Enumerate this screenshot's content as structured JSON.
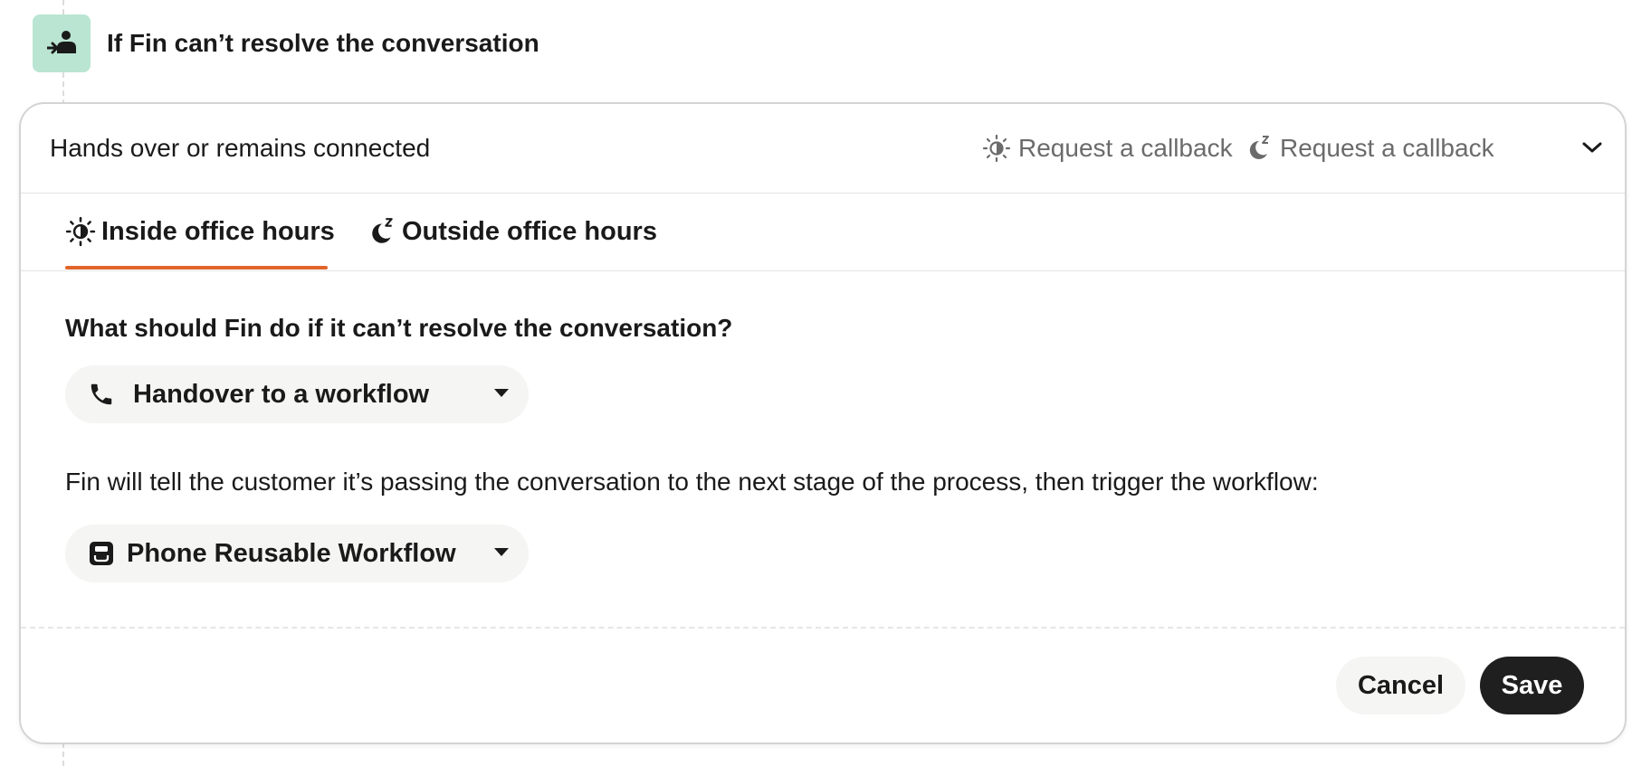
{
  "step": {
    "title": "If Fin can’t resolve the conversation",
    "icon": "handover-person-icon",
    "icon_bg": "#b9e5d2"
  },
  "card": {
    "summary": "Hands over or remains connected",
    "inside_chip": {
      "icon": "sun-icon",
      "label": "Request a callback"
    },
    "outside_chip": {
      "icon": "moon-z-icon",
      "label": "Request a callback"
    },
    "toggle_icon": "chevron-down-icon"
  },
  "tabs": [
    {
      "label": "Inside office hours",
      "icon": "sun-icon",
      "active": true
    },
    {
      "label": "Outside office hours",
      "icon": "moon-z-icon",
      "active": false
    }
  ],
  "accent_color": "#e2652b",
  "question": "What should Fin do if it can’t resolve the conversation?",
  "action_select": {
    "icon": "phone-icon",
    "value": "Handover to a workflow"
  },
  "explanation": "Fin will tell the customer it’s passing the conversation to the next stage of the process, then trigger the workflow:",
  "workflow_select": {
    "icon": "workflow-icon",
    "value": "Phone Reusable Workflow"
  },
  "footer": {
    "cancel_label": "Cancel",
    "save_label": "Save"
  }
}
